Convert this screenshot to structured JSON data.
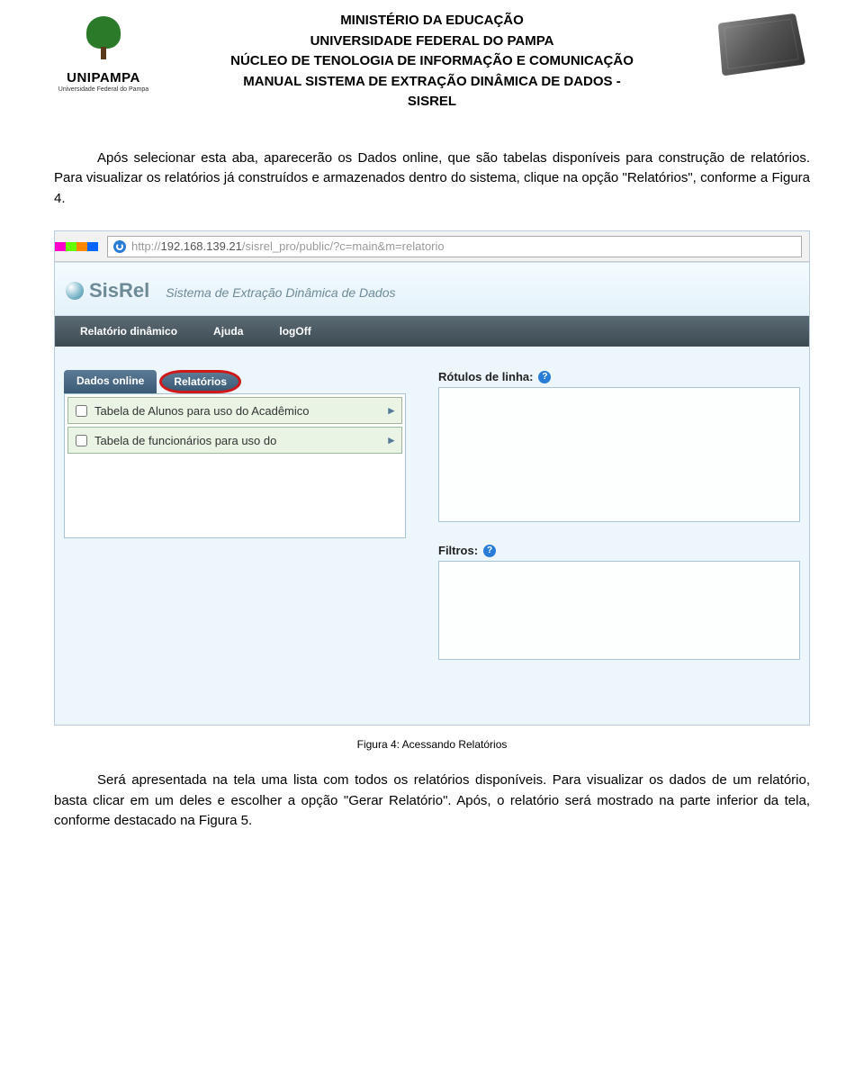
{
  "header": {
    "line1": "MINISTÉRIO DA EDUCAÇÃO",
    "line2": "UNIVERSIDADE FEDERAL DO PAMPA",
    "line3": "NÚCLEO DE TENOLOGIA DE INFORMAÇÃO E COMUNICAÇÃO",
    "line4": "MANUAL SISTEMA DE EXTRAÇÃO DINÂMICA DE DADOS -",
    "line5": "SISREL",
    "left_logo_text": "UNIPAMPA",
    "left_logo_sub": "Universidade Federal do Pampa"
  },
  "paragraph1": "Após selecionar esta aba, aparecerão os Dados online, que são tabelas disponíveis para construção de relatórios. Para visualizar os relatórios já construídos e armazenados dentro do sistema, clique na opção \"Relatórios\", conforme a Figura 4.",
  "screenshot": {
    "url_grey_prefix": "http://",
    "url_host": "192.168.139.21",
    "url_path": "/sisrel_pro/public/?c=main&m=relatorio",
    "app_name": "SisRel",
    "app_subtitle": "Sistema de Extração Dinâmica de Dados",
    "nav": [
      "Relatório dinâmico",
      "Ajuda",
      "logOff"
    ],
    "tabs": [
      "Dados online",
      "Relatórios"
    ],
    "list": [
      "Tabela de Alunos para uso do Acadêmico",
      "Tabela de funcionários para uso do"
    ],
    "right_label_rows": "Rótulos de linha:",
    "right_label_filters": "Filtros:"
  },
  "caption": "Figura 4: Acessando Relatórios",
  "paragraph2": "Será apresentada na tela uma lista com todos os relatórios disponíveis. Para visualizar os dados de um relatório, basta clicar em um deles e escolher a opção \"Gerar Relatório\". Após, o relatório será mostrado na parte inferior da tela, conforme destacado na Figura 5."
}
